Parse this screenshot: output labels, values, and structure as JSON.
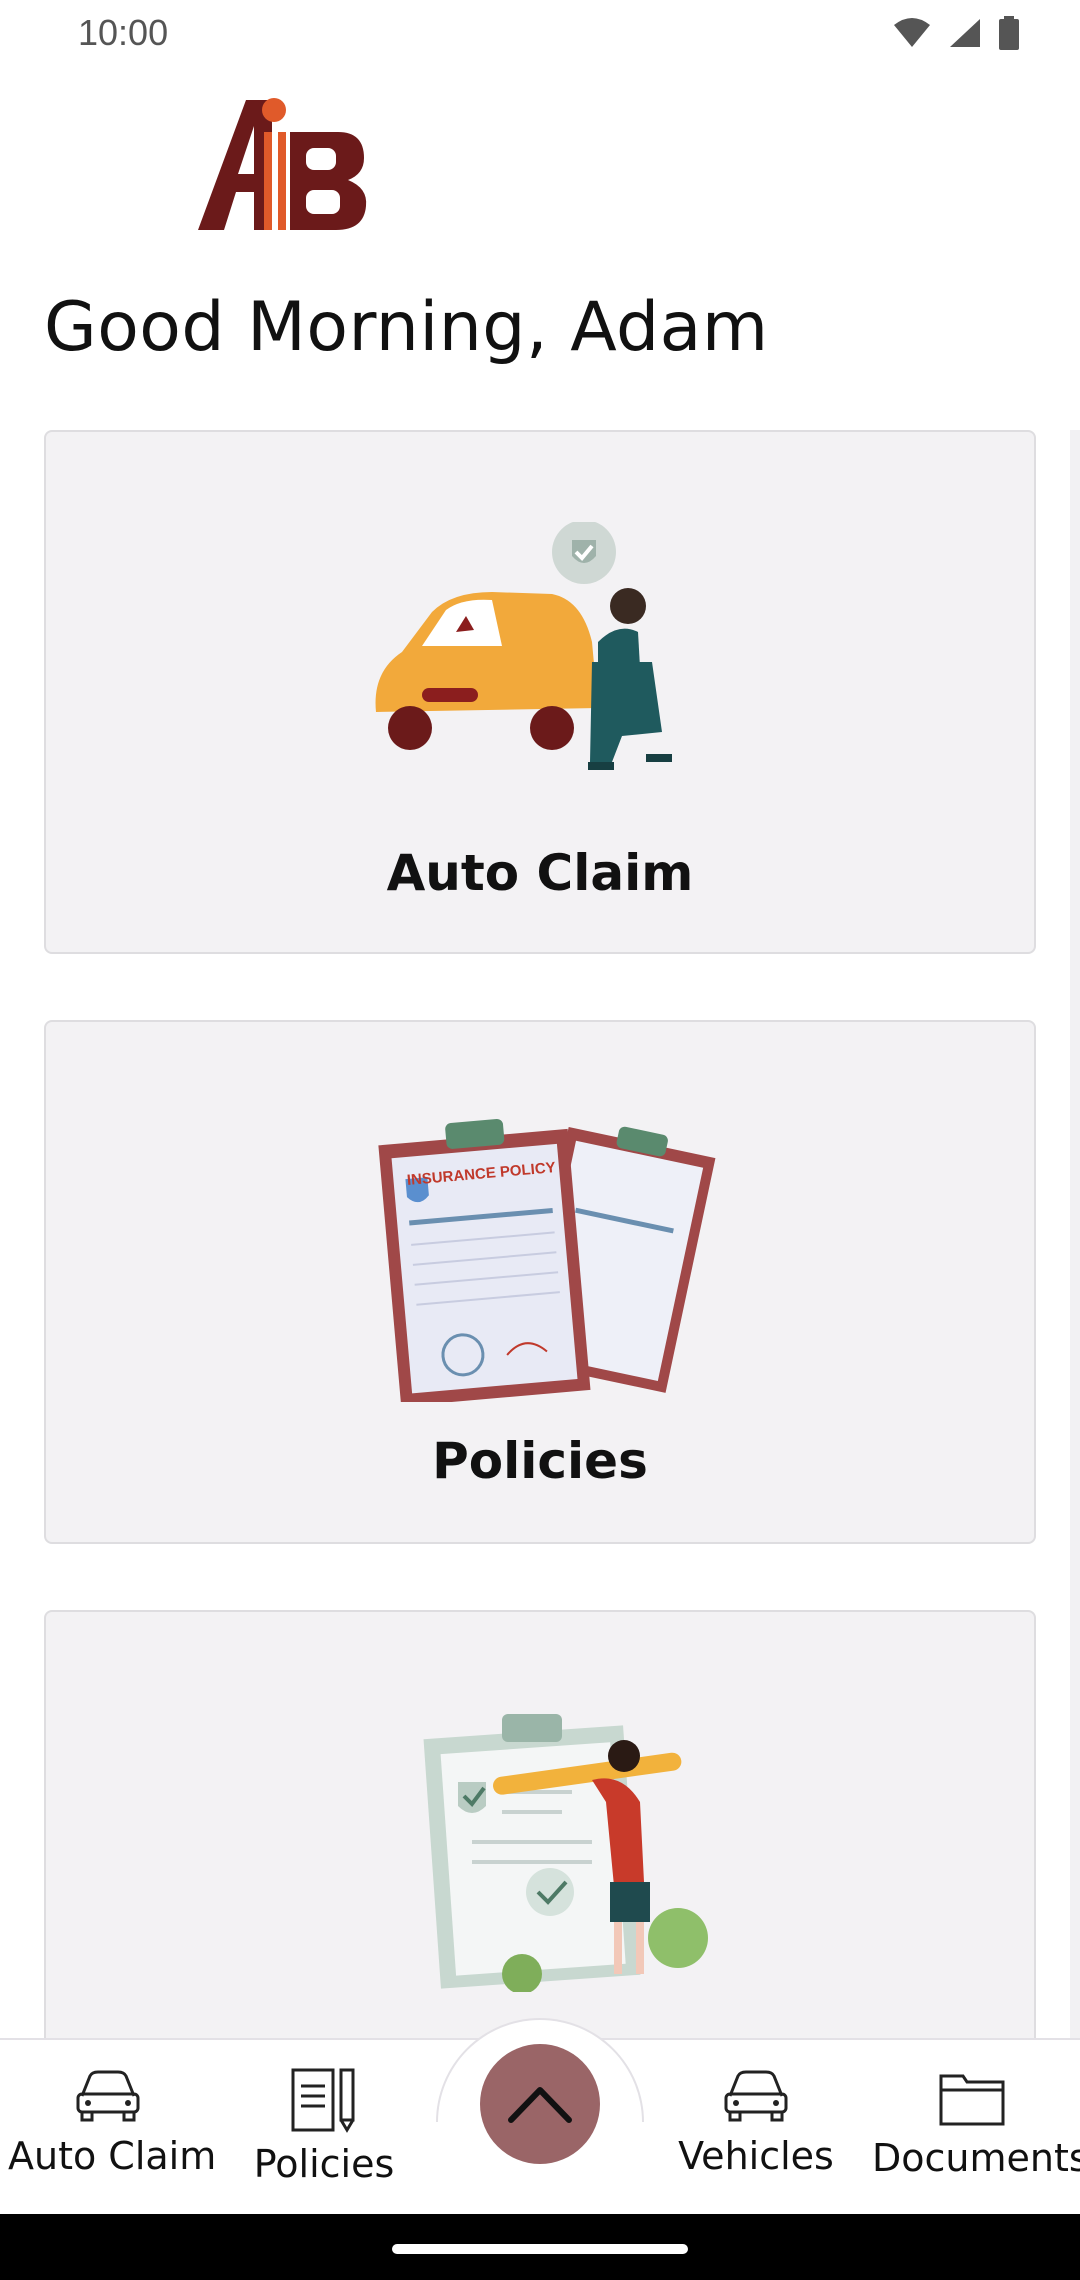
{
  "status_bar": {
    "time": "10:00"
  },
  "greeting": "Good Morning, Adam",
  "cards": [
    {
      "label": "Auto Claim",
      "icon": "car-claim-illustration"
    },
    {
      "label": "Policies",
      "icon": "insurance-policy-illustration",
      "illustration_text": "INSURANCE POLICY"
    },
    {
      "label": "",
      "icon": "checklist-illustration"
    }
  ],
  "bottom_nav": {
    "items": [
      {
        "label": "Auto Claim",
        "icon": "car-icon"
      },
      {
        "label": "Policies",
        "icon": "document-pen-icon"
      },
      {
        "label": "Vehicles",
        "icon": "car-icon"
      },
      {
        "label": "Documents",
        "icon": "folder-icon"
      }
    ],
    "fab_icon": "chevron-up-icon"
  },
  "colors": {
    "accent": "#9a6567",
    "logo_dark": "#6b1a1a",
    "logo_orange": "#e05a2a",
    "card_bg": "#f3f2f4"
  }
}
